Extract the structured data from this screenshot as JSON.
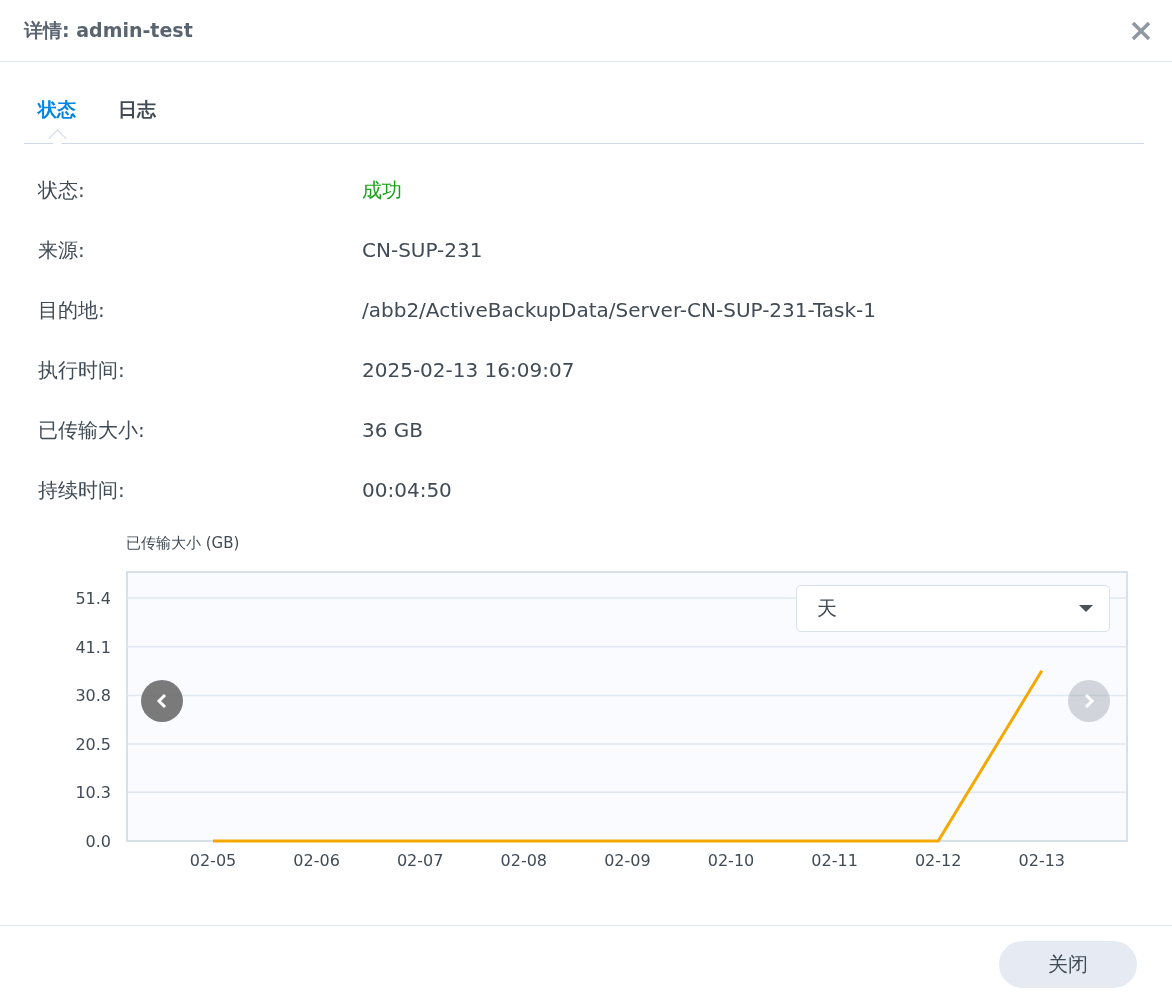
{
  "window": {
    "title": "详情: admin-test"
  },
  "tabs": [
    {
      "label": "状态",
      "selected": true
    },
    {
      "label": "日志",
      "selected": false
    }
  ],
  "details": [
    {
      "label": "状态:",
      "value": "成功",
      "kind": "success"
    },
    {
      "label": "来源:",
      "value": "CN-SUP-231",
      "kind": "text"
    },
    {
      "label": "目的地:",
      "value": "/abb2/ActiveBackupData/Server-CN-SUP-231-Task-1",
      "kind": "text"
    },
    {
      "label": "执行时间:",
      "value": "2025-02-13 16:09:07",
      "kind": "text"
    },
    {
      "label": "已传输大小:",
      "value": "36 GB",
      "kind": "text"
    },
    {
      "label": "持续时间:",
      "value": "00:04:50",
      "kind": "text"
    }
  ],
  "chart": {
    "period_select": {
      "value": "天"
    },
    "prev_disabled": false,
    "next_disabled": true,
    "chart_data": {
      "type": "line",
      "ylabel": "已传输大小 (GB)",
      "categories": [
        "02-05",
        "02-06",
        "02-07",
        "02-08",
        "02-09",
        "02-10",
        "02-11",
        "02-12",
        "02-13"
      ],
      "grid": true,
      "series": [
        {
          "color": "#f5a900",
          "values": [
            0,
            0,
            0,
            0,
            0,
            0,
            0,
            0,
            36
          ]
        }
      ],
      "ylim": [
        0,
        56.9
      ],
      "yticks": [
        {
          "value": 0,
          "label": "0.0"
        },
        {
          "value": 10.3,
          "label": "10.3"
        },
        {
          "value": 20.5,
          "label": "20.5"
        },
        {
          "value": 30.8,
          "label": "30.8"
        },
        {
          "value": 41.1,
          "label": "41.1"
        },
        {
          "value": 51.4,
          "label": "51.4"
        }
      ]
    }
  },
  "buttons": [
    {
      "label": "关闭"
    }
  ]
}
